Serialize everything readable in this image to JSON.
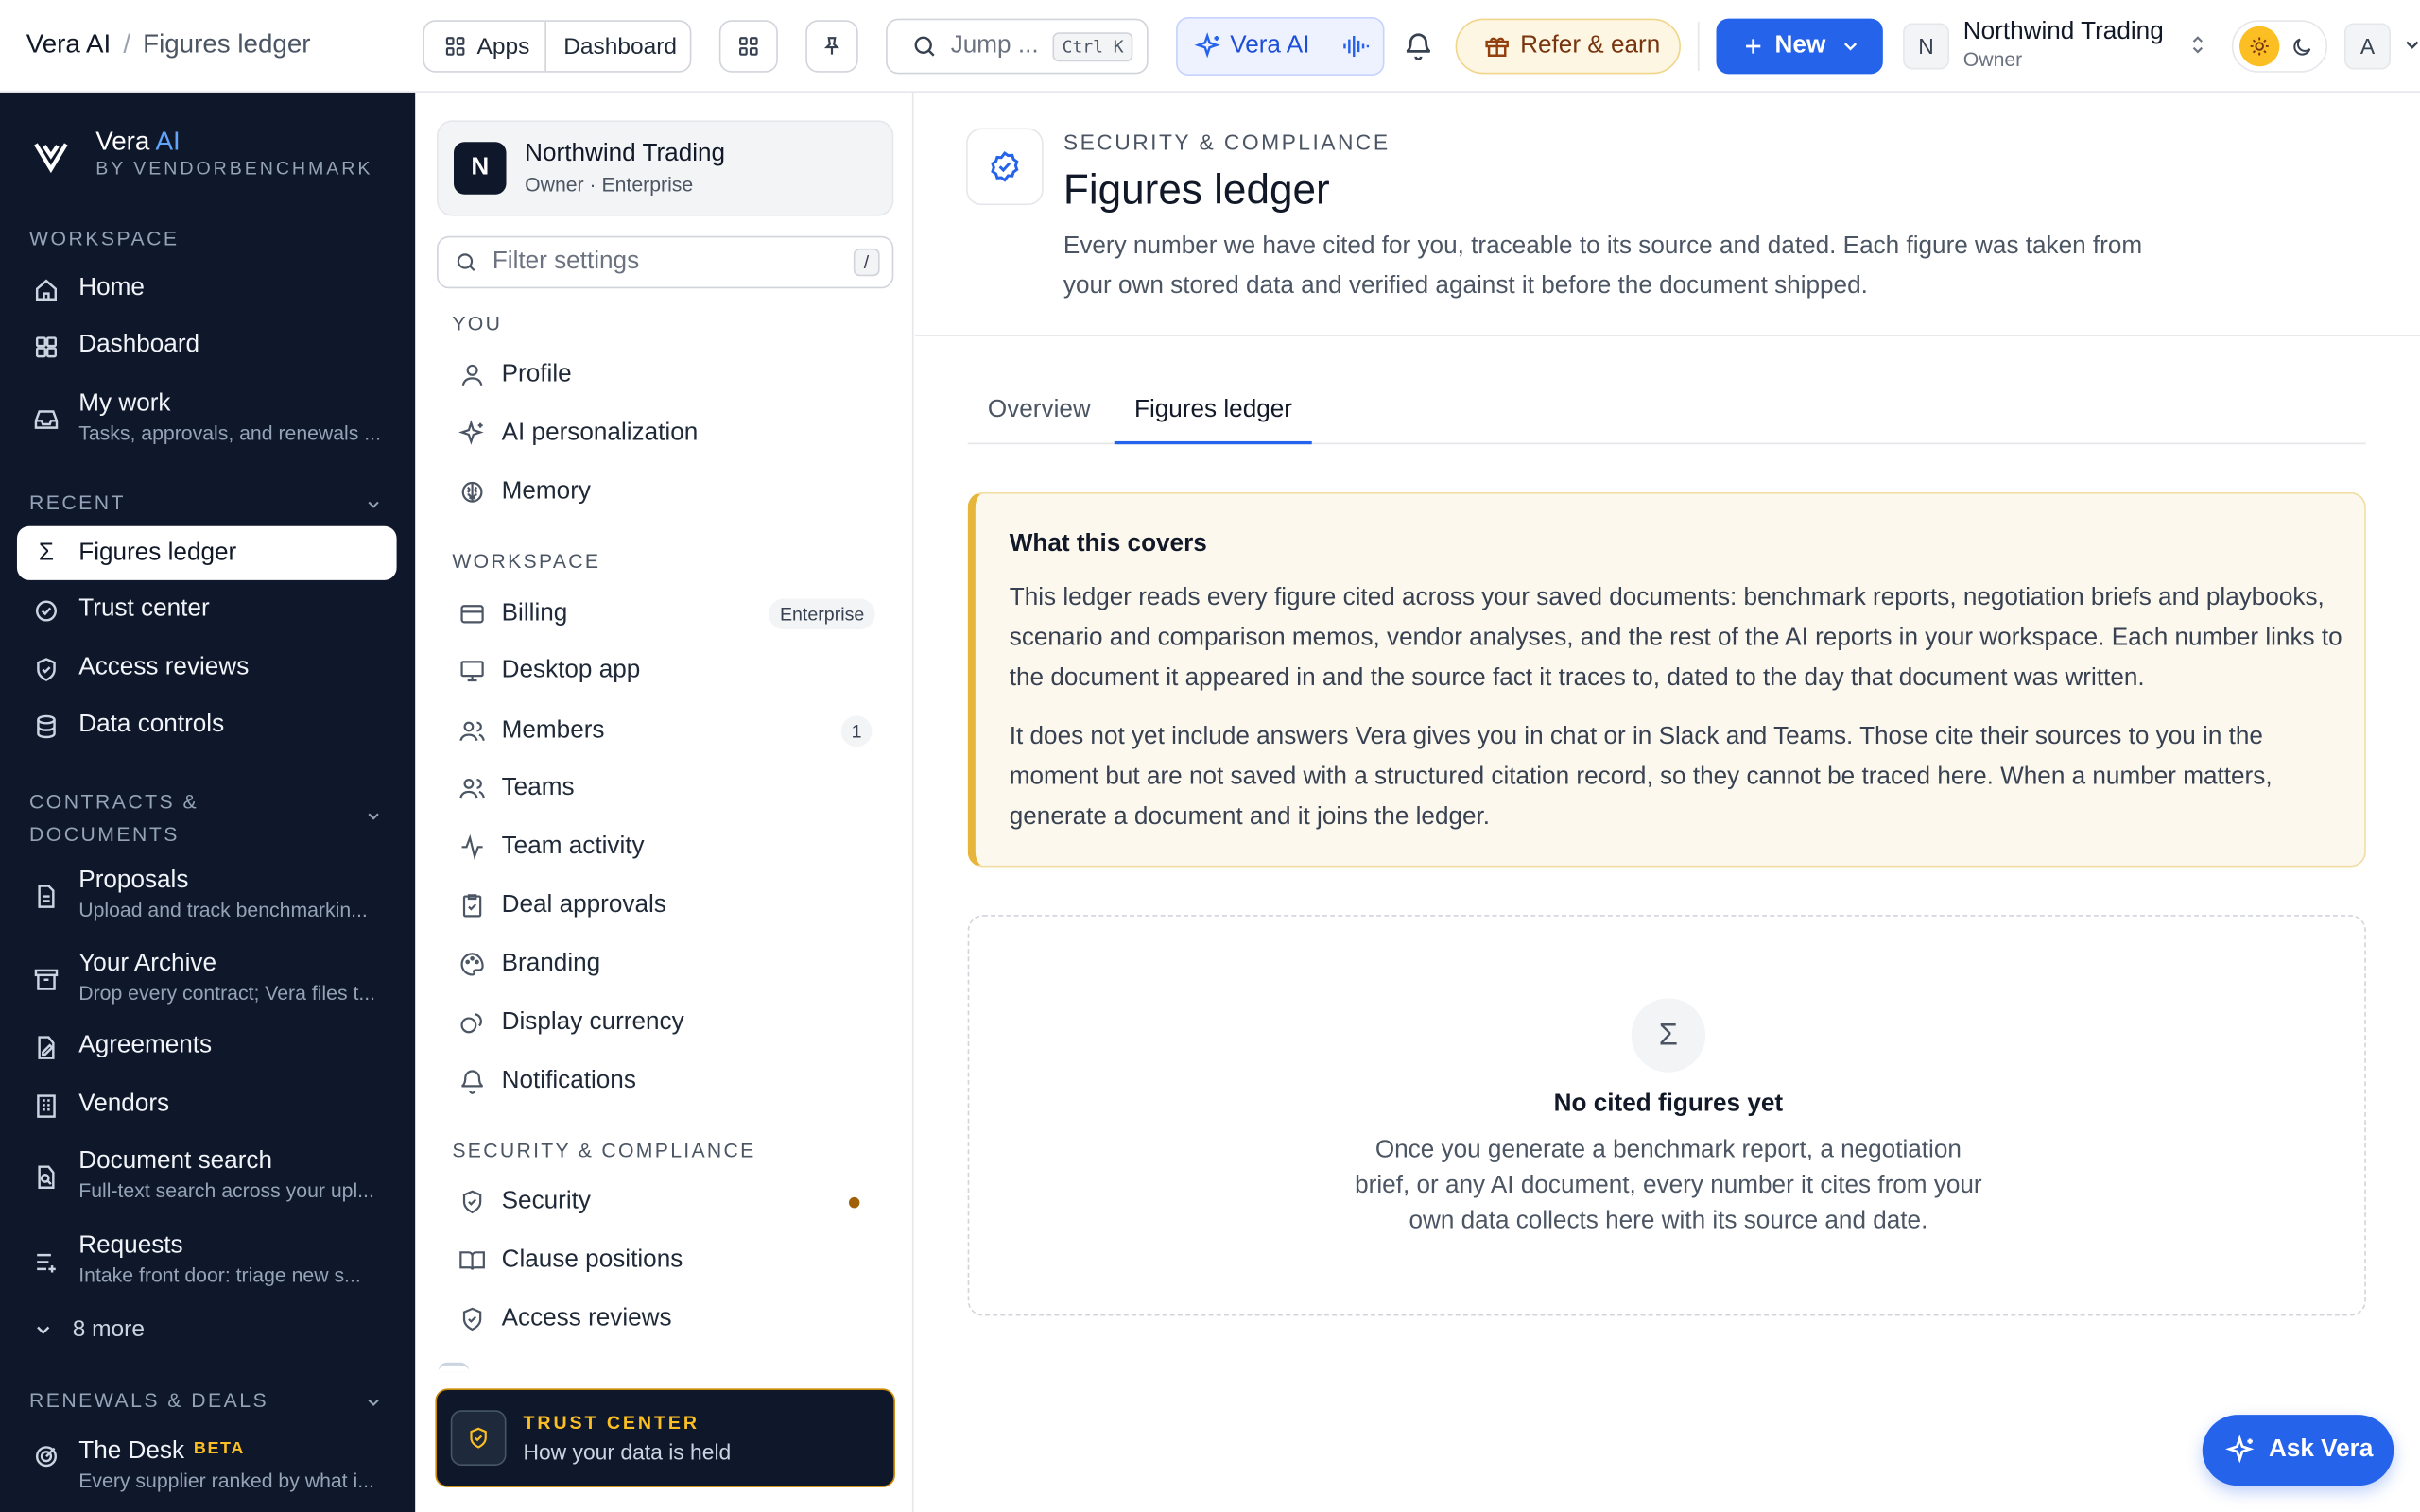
{
  "breadcrumb": {
    "root": "Vera AI",
    "sep": "/",
    "current": "Figures ledger"
  },
  "topbar": {
    "apps": "Apps",
    "dashboard": "Dashboard",
    "jump_placeholder": "Jump ...",
    "jump_shortcut": "Ctrl K",
    "vera_ai": "Vera AI",
    "refer": "Refer & earn",
    "new": "New",
    "org_initial": "N",
    "org_name": "Northwind Trading",
    "org_role": "Owner",
    "avatar": "A"
  },
  "brand": {
    "name": "Vera",
    "ai": "AI",
    "by": "BY VENDORBENCHMARK"
  },
  "sidebar": {
    "workspace_label": "WORKSPACE",
    "home": "Home",
    "dashboard": "Dashboard",
    "my_work": "My work",
    "my_work_sub": "Tasks, approvals, and renewals ...",
    "recent_label": "RECENT",
    "figures": "Figures ledger",
    "trust": "Trust center",
    "access": "Access reviews",
    "data": "Data controls",
    "contracts_label_1": "CONTRACTS &",
    "contracts_label_2": "DOCUMENTS",
    "proposals": "Proposals",
    "proposals_sub": "Upload and track benchmarkin...",
    "archive": "Your Archive",
    "archive_sub": "Drop every contract; Vera files t...",
    "agreements": "Agreements",
    "vendors": "Vendors",
    "docsearch": "Document search",
    "docsearch_sub": "Full-text search across your upl...",
    "requests": "Requests",
    "requests_sub": "Intake front door: triage new s...",
    "more": "8 more",
    "renewals_label": "RENEWALS & DEALS",
    "desk": "The Desk",
    "desk_badge": "BETA",
    "desk_sub": "Every supplier ranked by what i..."
  },
  "settings": {
    "org_initial": "N",
    "org_name": "Northwind Trading",
    "org_sub": "Owner · Enterprise",
    "filter_placeholder": "Filter settings",
    "filter_key": "/",
    "you_label": "YOU",
    "profile": "Profile",
    "ai_personalization": "AI personalization",
    "memory": "Memory",
    "workspace_label": "WORKSPACE",
    "billing": "Billing",
    "billing_badge": "Enterprise",
    "desktop": "Desktop app",
    "members": "Members",
    "members_count": "1",
    "teams": "Teams",
    "team_activity": "Team activity",
    "deal_approvals": "Deal approvals",
    "branding": "Branding",
    "display_currency": "Display currency",
    "notifications": "Notifications",
    "security_label": "SECURITY & COMPLIANCE",
    "security": "Security",
    "clause_positions": "Clause positions",
    "access_reviews": "Access reviews",
    "trust_title": "TRUST CENTER",
    "trust_sub": "How your data is held"
  },
  "header": {
    "eyebrow": "SECURITY & COMPLIANCE",
    "title": "Figures ledger",
    "desc_1": "Every number we have cited for you, traceable to its source and dated. Each figure was taken from",
    "desc_2": "your own stored data and verified against it before the document shipped."
  },
  "tabs": {
    "overview": "Overview",
    "ledger": "Figures ledger"
  },
  "covers": {
    "title": "What this covers",
    "p1_1": "This ledger reads every figure cited across your saved documents: benchmark reports, negotiation briefs and playbooks,",
    "p1_2": "scenario and comparison memos, vendor analyses, and the rest of the AI reports in your workspace. Each number links to",
    "p1_3": "the document it appeared in and the source fact it traces to, dated to the day that document was written.",
    "p2_1": "It does not yet include answers Vera gives you in chat or in Slack and Teams. Those cite their sources to you in the",
    "p2_2": "moment but are not saved with a structured citation record, so they cannot be traced here. When a number matters,",
    "p2_3": "generate a document and it joins the ledger."
  },
  "empty": {
    "symbol": "Σ",
    "title": "No cited figures yet",
    "l1": "Once you generate a benchmark report, a negotiation",
    "l2": "brief, or any AI document, every number it cites from your",
    "l3": "own data collects here with its source and date."
  },
  "ask": {
    "label": "Ask Vera"
  },
  "colors": {
    "primary": "#2563eb",
    "sidebar": "#0f172a",
    "warn_border": "#e6b53a",
    "warn_bg": "#fcf8ee",
    "accent_blue": "#60a5fa"
  }
}
